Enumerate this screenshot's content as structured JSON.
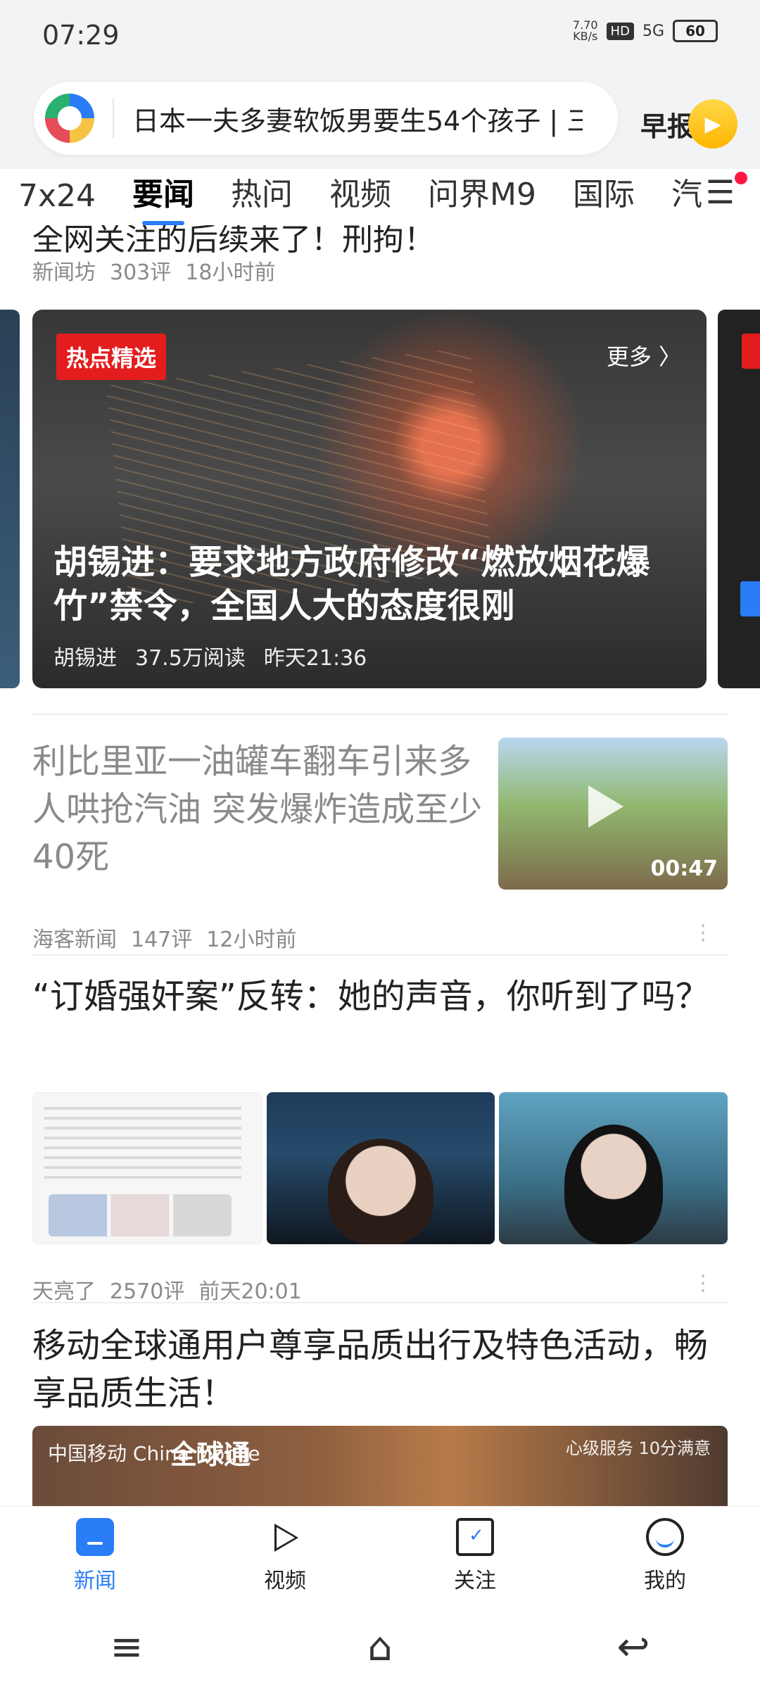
{
  "status": {
    "time": "07:29",
    "net_speed_value": "7.70",
    "net_speed_unit": "KB/s",
    "hd": "HD",
    "network": "5G",
    "battery": "60"
  },
  "search": {
    "query": "日本一夫多妻软饭男要生54个孩子 | 三",
    "morning_brief": "早报"
  },
  "tabs": [
    "7x24",
    "要闻",
    "热问",
    "视频",
    "问界M9",
    "国际",
    "汽"
  ],
  "top_cut": {
    "title": "全网关注的后续来了！刑拘！",
    "meta": [
      "新闻坊",
      "303评",
      "18小时前"
    ]
  },
  "hot_pick": {
    "badge": "热点精选",
    "more": "更多 〉",
    "title": "胡锡进：要求地方政府修改“燃放烟花爆竹”禁令，全国人大的态度很刚",
    "meta": [
      "胡锡进",
      "37.5万阅读",
      "昨天21:36"
    ]
  },
  "articles": [
    {
      "title": "利比里亚一油罐车翻车引来多人哄抢汽油 突发爆炸造成至少40死",
      "duration": "00:47",
      "meta": [
        "海客新闻",
        "147评",
        "12小时前"
      ]
    },
    {
      "title": "“订婚强奸案”反转：她的声音，你听到了吗？",
      "meta": [
        "天亮了",
        "2570评",
        "前天20:01"
      ]
    },
    {
      "title": "移动全球通用户尊享品质出行及特色活动，畅享品质生活！",
      "ad_texts": [
        "中国移动 China Mobile",
        "全球通",
        "心级服务 10分满意"
      ]
    }
  ],
  "bottom_nav": [
    "新闻",
    "视频",
    "关注",
    "我的"
  ],
  "system_nav": [
    "≡",
    "⌂",
    "↩"
  ]
}
